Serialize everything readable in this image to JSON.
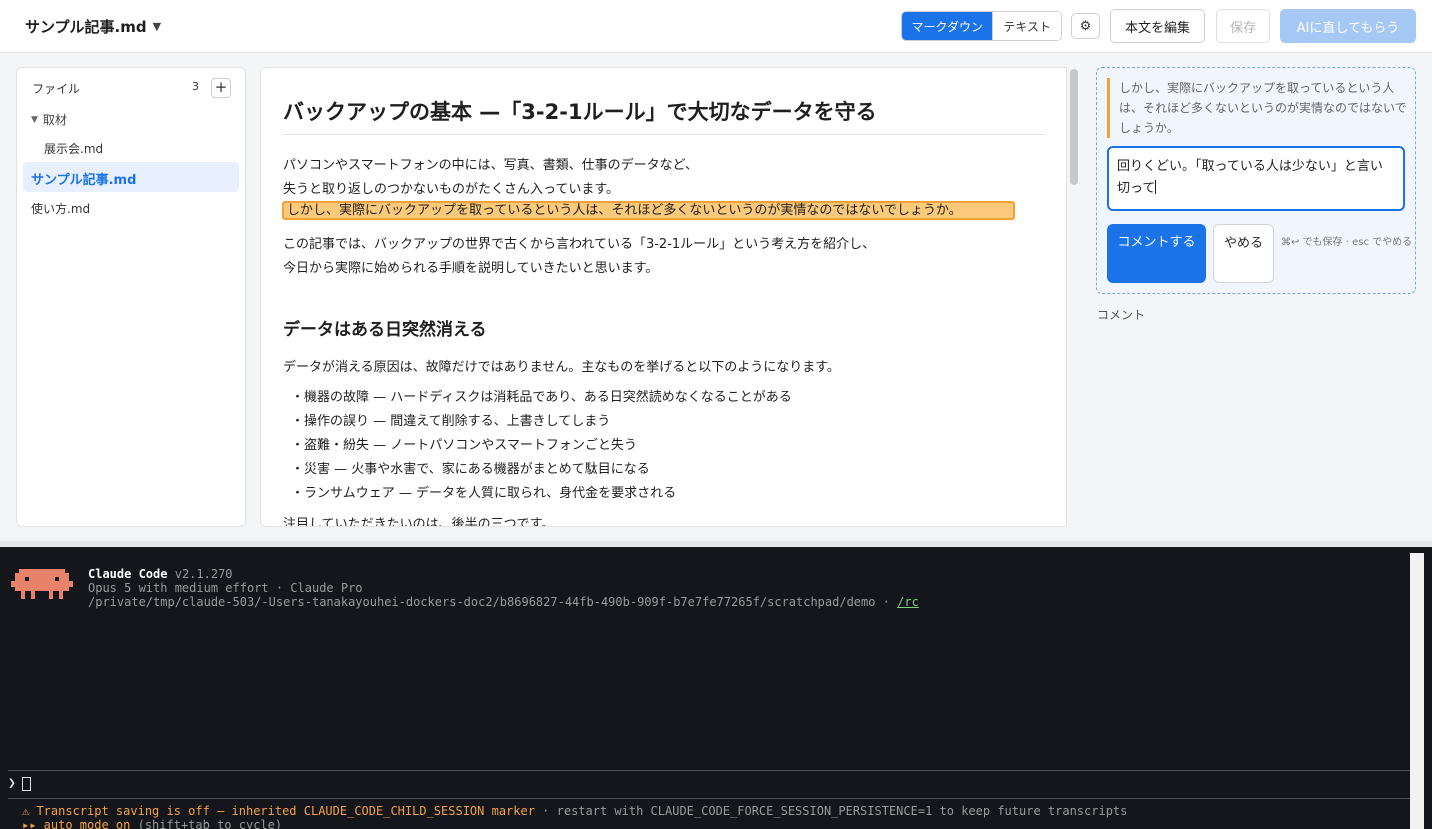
{
  "header": {
    "doc_title": "サンプル記事.md",
    "mode_markdown": "マークダウン",
    "mode_text": "テキスト",
    "edit_body": "本文を編集",
    "save": "保存",
    "ai_fix": "AIに直してもらう",
    "active_mode": "マークダウン"
  },
  "sidebar": {
    "title": "ファイル",
    "count": "3",
    "folder": "取材",
    "files": [
      {
        "label": "展示会.md"
      },
      {
        "label": "サンプル記事.md",
        "active": true
      },
      {
        "label": "使い方.md"
      }
    ]
  },
  "editor": {
    "h1": "バックアップの基本 —「3-2-1ルール」で大切なデータを守る",
    "p1_line1": "パソコンやスマートフォンの中には、写真、書類、仕事のデータなど、",
    "p1_line2": "失うと取り返しのつかないものがたくさん入っています。",
    "highlight": "しかし、実際にバックアップを取っているという人は、それほど多くないというのが実情なのではないでしょうか。",
    "p2_line1": "この記事では、バックアップの世界で古くから言われている「3-2-1ルール」という考え方を紹介し、",
    "p2_line2": "今日から実際に始められる手順を説明していきたいと思います。",
    "h2": "データはある日突然消える",
    "p3": "データが消える原因は、故障だけではありません。主なものを挙げると以下のようになります。",
    "list": [
      "・機器の故障 — ハードディスクは消耗品であり、ある日突然読めなくなることがある",
      "・操作の誤り — 間違えて削除する、上書きしてしまう",
      "・盗難・紛失 — ノートパソコンやスマートフォンごと失う",
      "・災害 — 火事や水害で、家にある機器がまとめて駄目になる",
      "・ランサムウェア — データを人質に取られ、身代金を要求される"
    ],
    "p4": "注目していただきたいのは、後半の三つです。"
  },
  "comment": {
    "quote": "しかし、実際にバックアップを取っているという人は、それほど多くないというのが実情なのではないでしょうか。",
    "input_value": "回りくどい。「取っている人は少ない」と言い切って",
    "submit": "コメントする",
    "cancel": "やめる",
    "hint": "⌘↩ でも保存 · esc でやめる",
    "section_label": "コメント"
  },
  "terminal": {
    "app_name": "Claude Code",
    "version": "v2.1.270",
    "model_line": "Opus 5 with medium effort · Claude Pro",
    "path": "/private/tmp/claude-503/-Users-tanakayouhei-dockers-doc2/b8696827-44fb-490b-909f-b7e7fe77265f/scratchpad/demo · ",
    "rc_link": "/rc",
    "prompt_symbol": "❯",
    "warning_main": "⚠ Transcript saving is off — inherited CLAUDE_CODE_CHILD_SESSION marker",
    "warning_rest": " · restart with CLAUDE_CODE_FORCE_SESSION_PERSISTENCE=1 to keep future transcripts",
    "auto_mode": "▸▸ auto mode on",
    "auto_hint": " (shift+tab to cycle)"
  },
  "icons": {
    "dropdown": "chevron-down-icon",
    "settings": "gear-icon",
    "add": "plus-icon",
    "folder_toggle": "triangle-down-icon",
    "logo": "claude-code-logo"
  },
  "colors": {
    "accent": "#1a73e8",
    "highlight": "#fbc97a",
    "highlight_border": "#f0a238",
    "terminal_bg": "#14161c",
    "warning": "#f2a340",
    "logo": "#e8826a"
  }
}
